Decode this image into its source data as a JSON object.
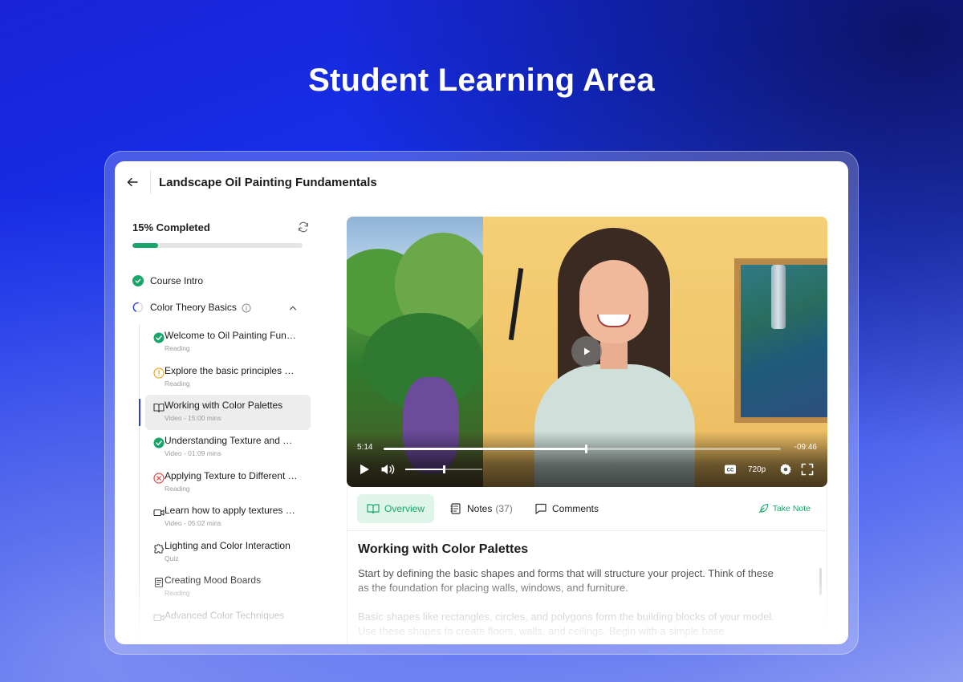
{
  "hero": {
    "title": "Student Learning Area"
  },
  "topbar": {
    "course_title": "Landscape Oil Painting Fundamentals"
  },
  "progress": {
    "label": "15% Completed",
    "percent": 15,
    "accent": "#18a66a"
  },
  "sections": [
    {
      "label": "Course Intro",
      "status": "complete"
    },
    {
      "label": "Color Theory Basics",
      "status": "in-progress",
      "expanded": true
    }
  ],
  "lessons": [
    {
      "title": "Welcome to Oil Painting Fundamentals",
      "sub": "Reading",
      "status": "complete-icon"
    },
    {
      "title": "Explore the basic principles of color",
      "sub": "Reading",
      "status": "warning-icon"
    },
    {
      "title": "Working with Color Palettes",
      "sub": "Video - 15:00 mins",
      "status": "book-icon",
      "active": true
    },
    {
      "title": "Understanding Texture and Form",
      "sub": "Video - 01:09 mins",
      "status": "complete-icon"
    },
    {
      "title": "Applying Texture to Different Surfaces",
      "sub": "Reading",
      "status": "error-icon"
    },
    {
      "title": "Learn how to apply textures to canvas",
      "sub": "Video - 05:02 mins",
      "status": "video-icon"
    },
    {
      "title": "Lighting and Color Interaction",
      "sub": "Quiz",
      "status": "puzzle-icon"
    },
    {
      "title": "Creating Mood Boards",
      "sub": "Reading",
      "status": "document-icon"
    },
    {
      "title": "Advanced Color Techniques",
      "sub": "",
      "status": "video-icon"
    }
  ],
  "video": {
    "elapsed": "5:14",
    "remaining": "-09:46",
    "progress": 0.51,
    "volume": 0.5,
    "quality": "720p"
  },
  "tabs": [
    {
      "label": "Overview",
      "active": true
    },
    {
      "label": "Notes",
      "count": "(37)"
    },
    {
      "label": "Comments"
    }
  ],
  "take_note_label": "Take Note",
  "content": {
    "title": "Working with Color Palettes",
    "paragraph1": "Start by defining the basic shapes and forms that will structure your project. Think of these as the foundation for placing walls, windows, and furniture.",
    "paragraph2": "Basic shapes like rectangles, circles, and polygons form the building blocks of your model. Use these shapes to create floors, walls, and ceilings. Begin with a simple base"
  }
}
